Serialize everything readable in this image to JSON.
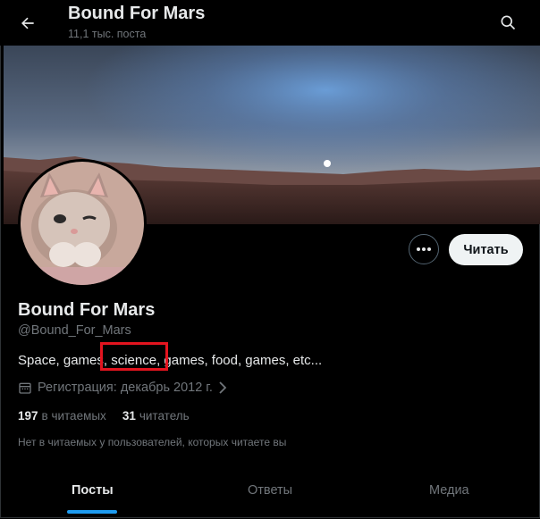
{
  "header": {
    "title": "Bound For Mars",
    "subtitle": "11,1 тыс. поста"
  },
  "profile": {
    "more_icon": "dots-horizontal",
    "follow_label": "Читать",
    "name": "Bound For Mars",
    "handle": "@Bound_For_Mars",
    "bio": "Space, games, science, games, food, games, etc...",
    "joined": "Регистрация: декабрь 2012 г.",
    "following_count": "197",
    "following_label": "в читаемых",
    "followers_count": "31",
    "followers_label": "читатель",
    "followers_note": "Нет в читаемых у пользователей, которых читаете вы"
  },
  "tabs": [
    {
      "label": "Посты",
      "active": true
    },
    {
      "label": "Ответы",
      "active": false
    },
    {
      "label": "Медиа",
      "active": false
    }
  ],
  "colors": {
    "accent": "#1d9bf0",
    "highlight_box": "#e3141f"
  }
}
